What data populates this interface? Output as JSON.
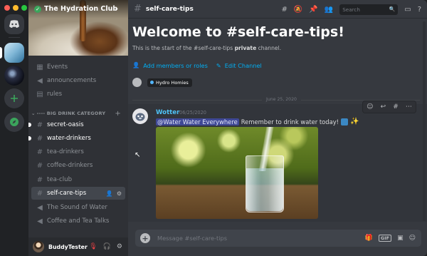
{
  "server": {
    "name": "The Hydration Club"
  },
  "sidebar": {
    "category": "---- BIG DRINK CATEGORY",
    "top_items": [
      {
        "label": "Events",
        "icon": "calendar-icon"
      },
      {
        "label": "announcements",
        "icon": "megaphone-icon"
      },
      {
        "label": "rules",
        "icon": "rules-icon"
      }
    ],
    "channels": [
      {
        "label": "secret-oasis",
        "unread": true
      },
      {
        "label": "water-drinkers",
        "unread": true
      },
      {
        "label": "tea-drinkers",
        "unread": false
      },
      {
        "label": "coffee-drinkers",
        "unread": false
      },
      {
        "label": "tea-club",
        "unread": false
      },
      {
        "label": "self-care-tips",
        "active": true
      },
      {
        "label": "The Sound of Water",
        "type": "voice"
      },
      {
        "label": "Coffee and Tea Talks",
        "type": "voice"
      }
    ]
  },
  "user": {
    "name": "BuddyTester"
  },
  "topbar": {
    "channel": "self-care-tips",
    "search_placeholder": "Search"
  },
  "welcome": {
    "title": "Welcome to #self-care-tips!",
    "subtitle_prefix": "This is the start of the #self-care-tips ",
    "subtitle_bold": "private",
    "subtitle_suffix": " channel.",
    "add_members": "Add members or roles",
    "edit_channel": "Edit Channel",
    "role": "Hydro Homies"
  },
  "divider": {
    "date": "June 25, 2020"
  },
  "message": {
    "author": "Wotter",
    "timestamp": "06/25/2020",
    "mention": "@Water Water Everywhere",
    "text": "Remember to drink water today!"
  },
  "composer": {
    "placeholder": "Message #self-care-tips",
    "gif_label": "GIF"
  },
  "colors": {
    "accent": "#00aff4",
    "author": "#4fc3f7",
    "online": "#3ba55c",
    "muted": "#ed4245"
  }
}
